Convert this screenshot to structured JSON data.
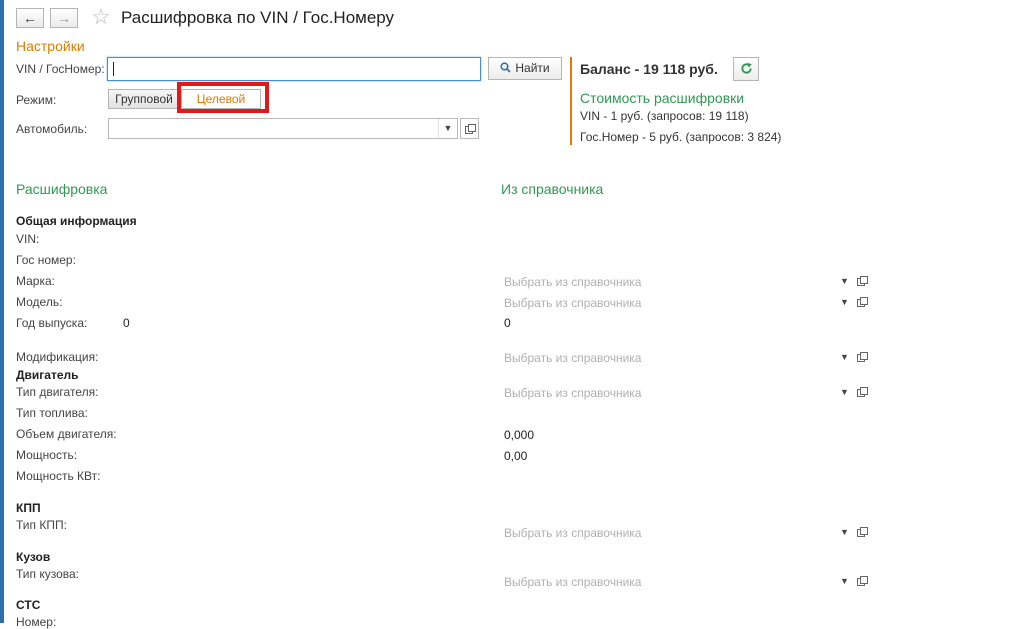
{
  "header": {
    "title": "Расшифровка по VIN / Гос.Номеру",
    "back_icon": "←",
    "forward_icon": "→",
    "star_icon": "☆"
  },
  "settings": {
    "section_title": "Настройки",
    "vin_label": "VIN / ГосНомер:",
    "vin_value": "",
    "find_button": "Найти",
    "mode_label": "Режим:",
    "mode_group": "Групповой",
    "mode_target": "Целевой",
    "car_label": "Автомобиль:",
    "car_value": ""
  },
  "balance": {
    "title": "Баланс - 19 118 руб.",
    "cost_title": "Стоимость расшифровки",
    "vin_cost": "VIN - 1 руб. (запросов: 19 118)",
    "plate_cost": "Гос.Номер - 5 руб. (запросов: 3 824)"
  },
  "decode": {
    "left_title": "Расшифровка",
    "right_title": "Из справочника",
    "placeholder": "Выбрать из справочника",
    "general_title": "Общая информация",
    "vin": "VIN:",
    "plate": "Гос номер:",
    "brand": "Марка:",
    "model": "Модель:",
    "year": "Год выпуска:",
    "year_value": "0",
    "year_ref_value": "0",
    "modification": "Модификация:",
    "engine_title": "Двигатель",
    "engine_type": "Тип двигателя:",
    "fuel_type": "Тип топлива:",
    "engine_volume": "Объем двигателя:",
    "engine_volume_value": "0,000",
    "power": "Мощность:",
    "power_value": "0,00",
    "power_kw": "Мощность КВт:",
    "gearbox_title": "КПП",
    "gearbox_type": "Тип КПП:",
    "body_title": "Кузов",
    "body_type": "Тип кузова:",
    "sts_title": "СТС",
    "number": "Номер:"
  },
  "colors": {
    "accent_orange": "#e07b00",
    "accent_green": "#2e9a52",
    "highlight_red": "#e01a1a"
  }
}
